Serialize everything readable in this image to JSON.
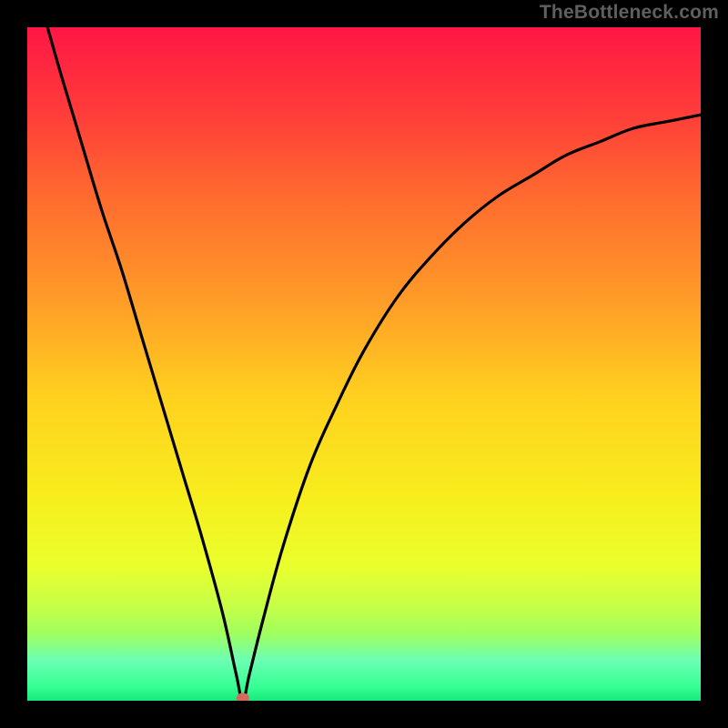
{
  "attribution": "TheBottleneck.com",
  "colors": {
    "frame": "#000000",
    "curve": "#000000",
    "dot": "#d66a5a",
    "attribution_text": "#5f5f5f",
    "gradient_stops": [
      {
        "offset": 0.0,
        "color": "#ff1745"
      },
      {
        "offset": 0.12,
        "color": "#ff3a3a"
      },
      {
        "offset": 0.25,
        "color": "#ff6a2f"
      },
      {
        "offset": 0.4,
        "color": "#ff9a28"
      },
      {
        "offset": 0.55,
        "color": "#ffd11f"
      },
      {
        "offset": 0.7,
        "color": "#f7ee1d"
      },
      {
        "offset": 0.8,
        "color": "#eaff2c"
      },
      {
        "offset": 0.86,
        "color": "#c6ff47"
      },
      {
        "offset": 0.9,
        "color": "#a0ff5e"
      },
      {
        "offset": 0.94,
        "color": "#6cffb4"
      },
      {
        "offset": 0.98,
        "color": "#35ff92"
      },
      {
        "offset": 1.0,
        "color": "#18e87a"
      }
    ]
  },
  "chart_data": {
    "type": "line",
    "title": "",
    "xlabel": "",
    "ylabel": "",
    "xlim": [
      0,
      100
    ],
    "ylim": [
      0,
      100
    ],
    "grid": false,
    "curve_minimum_x": 32,
    "marker": {
      "x": 32,
      "y": 0
    },
    "series": [
      {
        "name": "bottleneck-curve",
        "x": [
          3,
          5,
          8,
          11,
          14,
          17,
          20,
          23,
          26,
          29,
          31,
          32,
          33,
          35,
          38,
          42,
          46,
          50,
          55,
          60,
          65,
          70,
          75,
          80,
          85,
          90,
          95,
          100
        ],
        "values": [
          100,
          93,
          83,
          73,
          64,
          54,
          44,
          34,
          24,
          13,
          4,
          0,
          4,
          12,
          23,
          35,
          44,
          52,
          60,
          66,
          71,
          75,
          78,
          81,
          83,
          85,
          86,
          87
        ]
      }
    ]
  }
}
